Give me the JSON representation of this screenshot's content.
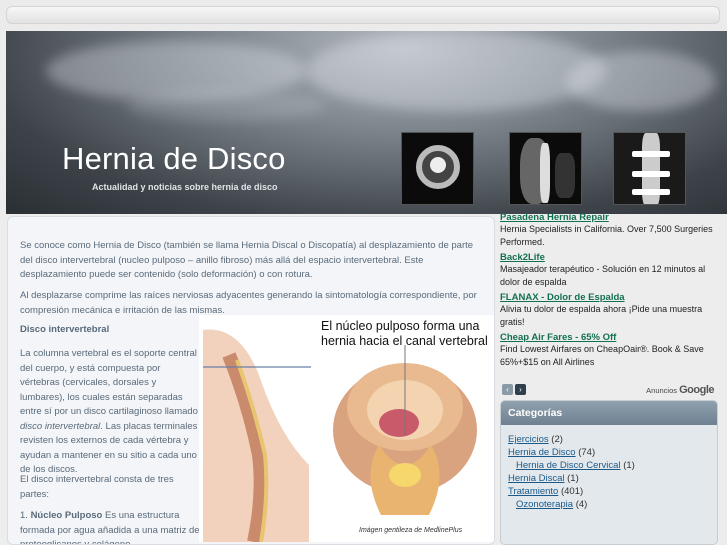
{
  "header": {
    "title": "Hernia de Disco",
    "subtitle": "Actualidad y noticias sobre hernia de disco"
  },
  "content": {
    "para1": "Se conoce como Hernia de Disco (también se llama Hernia Discal o Discopatía) al desplazamiento de parte del disco intervertebral (nucleo pulposo – anillo fibroso) más allá del espacio intervertebral. Este desplazamiento puede ser contenido (solo deformación) o con rotura.",
    "para2": "Al desplazarse comprime las raíces nerviosas adyacentes generando la sintomatología correspondiente, por compresión mecánica e irritación de las mismas.",
    "heading": "Disco intervertebral",
    "para3_a": "La columna vertebral es el soporte central del cuerpo, y está compuesta por vértebras (cervicales, dorsales y lumbares), los cuales están separadas entre sí por un disco cartilaginoso llamado ",
    "para3_italic": "disco intervertebral",
    "para3_b": ". Las placas terminales revisten los externos de cada vértebra y ayudan a mantener en su sitio a cada uno de los discos.",
    "para4": "El disco intervertebral consta de tres partes:",
    "para5_num": "1. ",
    "para5_bold": "Núcleo Pulposo",
    "para5_rest": " Es una estructura formada por agua añadida a una matriz de proteoglicanos y colágeno",
    "figure_caption": "El núcleo pulposo forma una hernia hacia el canal vertebral",
    "figure_credit": "Imágen gentileza de MedlinePlus"
  },
  "ads": {
    "items": [
      {
        "title": "Pasadena Hernia Repair",
        "desc": "Hernia Specialists in California. Over 7,500 Surgeries Performed."
      },
      {
        "title": "Back2Life",
        "desc": "Masajeador terapéutico - Solución en 12 minutos al dolor de espalda"
      },
      {
        "title": "FLANAX - Dolor de Espalda",
        "desc": "Alivia tu dolor de espalda ahora ¡Pide una muestra gratis!"
      },
      {
        "title": "Cheap Air Fares - 65% Off",
        "desc": "Find Lowest Airfares on CheapOair®. Book & Save 65%+$15 on All Airlines"
      }
    ],
    "prev_label": "‹",
    "next_label": "›",
    "ads_by": "Anuncios",
    "ads_by_brand": "Google"
  },
  "categories": {
    "title": "Categorías",
    "items": [
      {
        "label": "Ejercicios",
        "count": "(2)"
      },
      {
        "label": "Hernia de Disco",
        "count": "(74)"
      },
      {
        "label": "Hernia de Disco Cervical",
        "count": "(1)"
      },
      {
        "label": "Hernia Discal",
        "count": "(1)"
      },
      {
        "label": "Tratamiento",
        "count": "(401)"
      },
      {
        "label": "Ozonoterapia",
        "count": "(4)"
      }
    ]
  },
  "colors": {
    "ad_title": "#13704f",
    "text": "#5a6a7a",
    "category_header": "#7a8c9b"
  }
}
